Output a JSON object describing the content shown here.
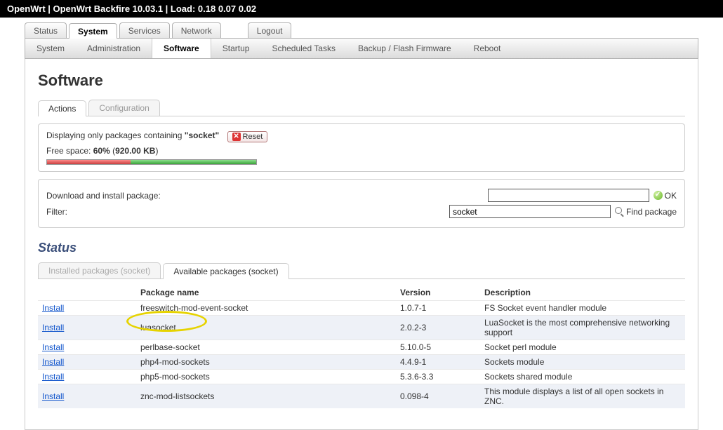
{
  "topbar": "OpenWrt | OpenWrt Backfire 10.03.1 | Load: 0.18 0.07 0.02",
  "mainTabs": [
    "Status",
    "System",
    "Services",
    "Network"
  ],
  "mainTabActive": 1,
  "logoutLabel": "Logout",
  "subnav": [
    "System",
    "Administration",
    "Software",
    "Startup",
    "Scheduled Tasks",
    "Backup / Flash Firmware",
    "Reboot"
  ],
  "subnavActive": 2,
  "pageTitle": "Software",
  "filterTabs": {
    "actions": "Actions",
    "configuration": "Configuration",
    "activeIndex": 0
  },
  "filter": {
    "displaying_prefix": "Displaying only packages containing ",
    "displaying_term": "\"socket\"",
    "reset_label": "Reset",
    "free_space_prefix": "Free space: ",
    "free_space_pct": "60%",
    "free_space_size": "(920.00 KB)",
    "bar_used_pct": 40,
    "bar_free_pct": 60
  },
  "download": {
    "label": "Download and install package:",
    "value": "",
    "ok_label": "OK",
    "filter_label": "Filter:",
    "filter_value": "socket",
    "find_label": "Find package"
  },
  "statusHeading": "Status",
  "pkgTabs": {
    "installed": "Installed packages (socket)",
    "available": "Available packages (socket)",
    "activeIndex": 1
  },
  "cols": {
    "action": "",
    "name": "Package name",
    "version": "Version",
    "desc": "Description"
  },
  "installLabel": "Install",
  "packages": [
    {
      "name": "freeswitch-mod-event-socket",
      "version": "1.0.7-1",
      "desc": "FS Socket event handler module"
    },
    {
      "name": "luasocket",
      "version": "2.0.2-3",
      "desc": "LuaSocket is the most comprehensive networking support"
    },
    {
      "name": "perlbase-socket",
      "version": "5.10.0-5",
      "desc": "Socket perl module"
    },
    {
      "name": "php4-mod-sockets",
      "version": "4.4.9-1",
      "desc": "Sockets module"
    },
    {
      "name": "php5-mod-sockets",
      "version": "5.3.6-3.3",
      "desc": "Sockets shared module"
    },
    {
      "name": "znc-mod-listsockets",
      "version": "0.098-4",
      "desc": "This module displays a list of all open sockets in ZNC."
    }
  ]
}
